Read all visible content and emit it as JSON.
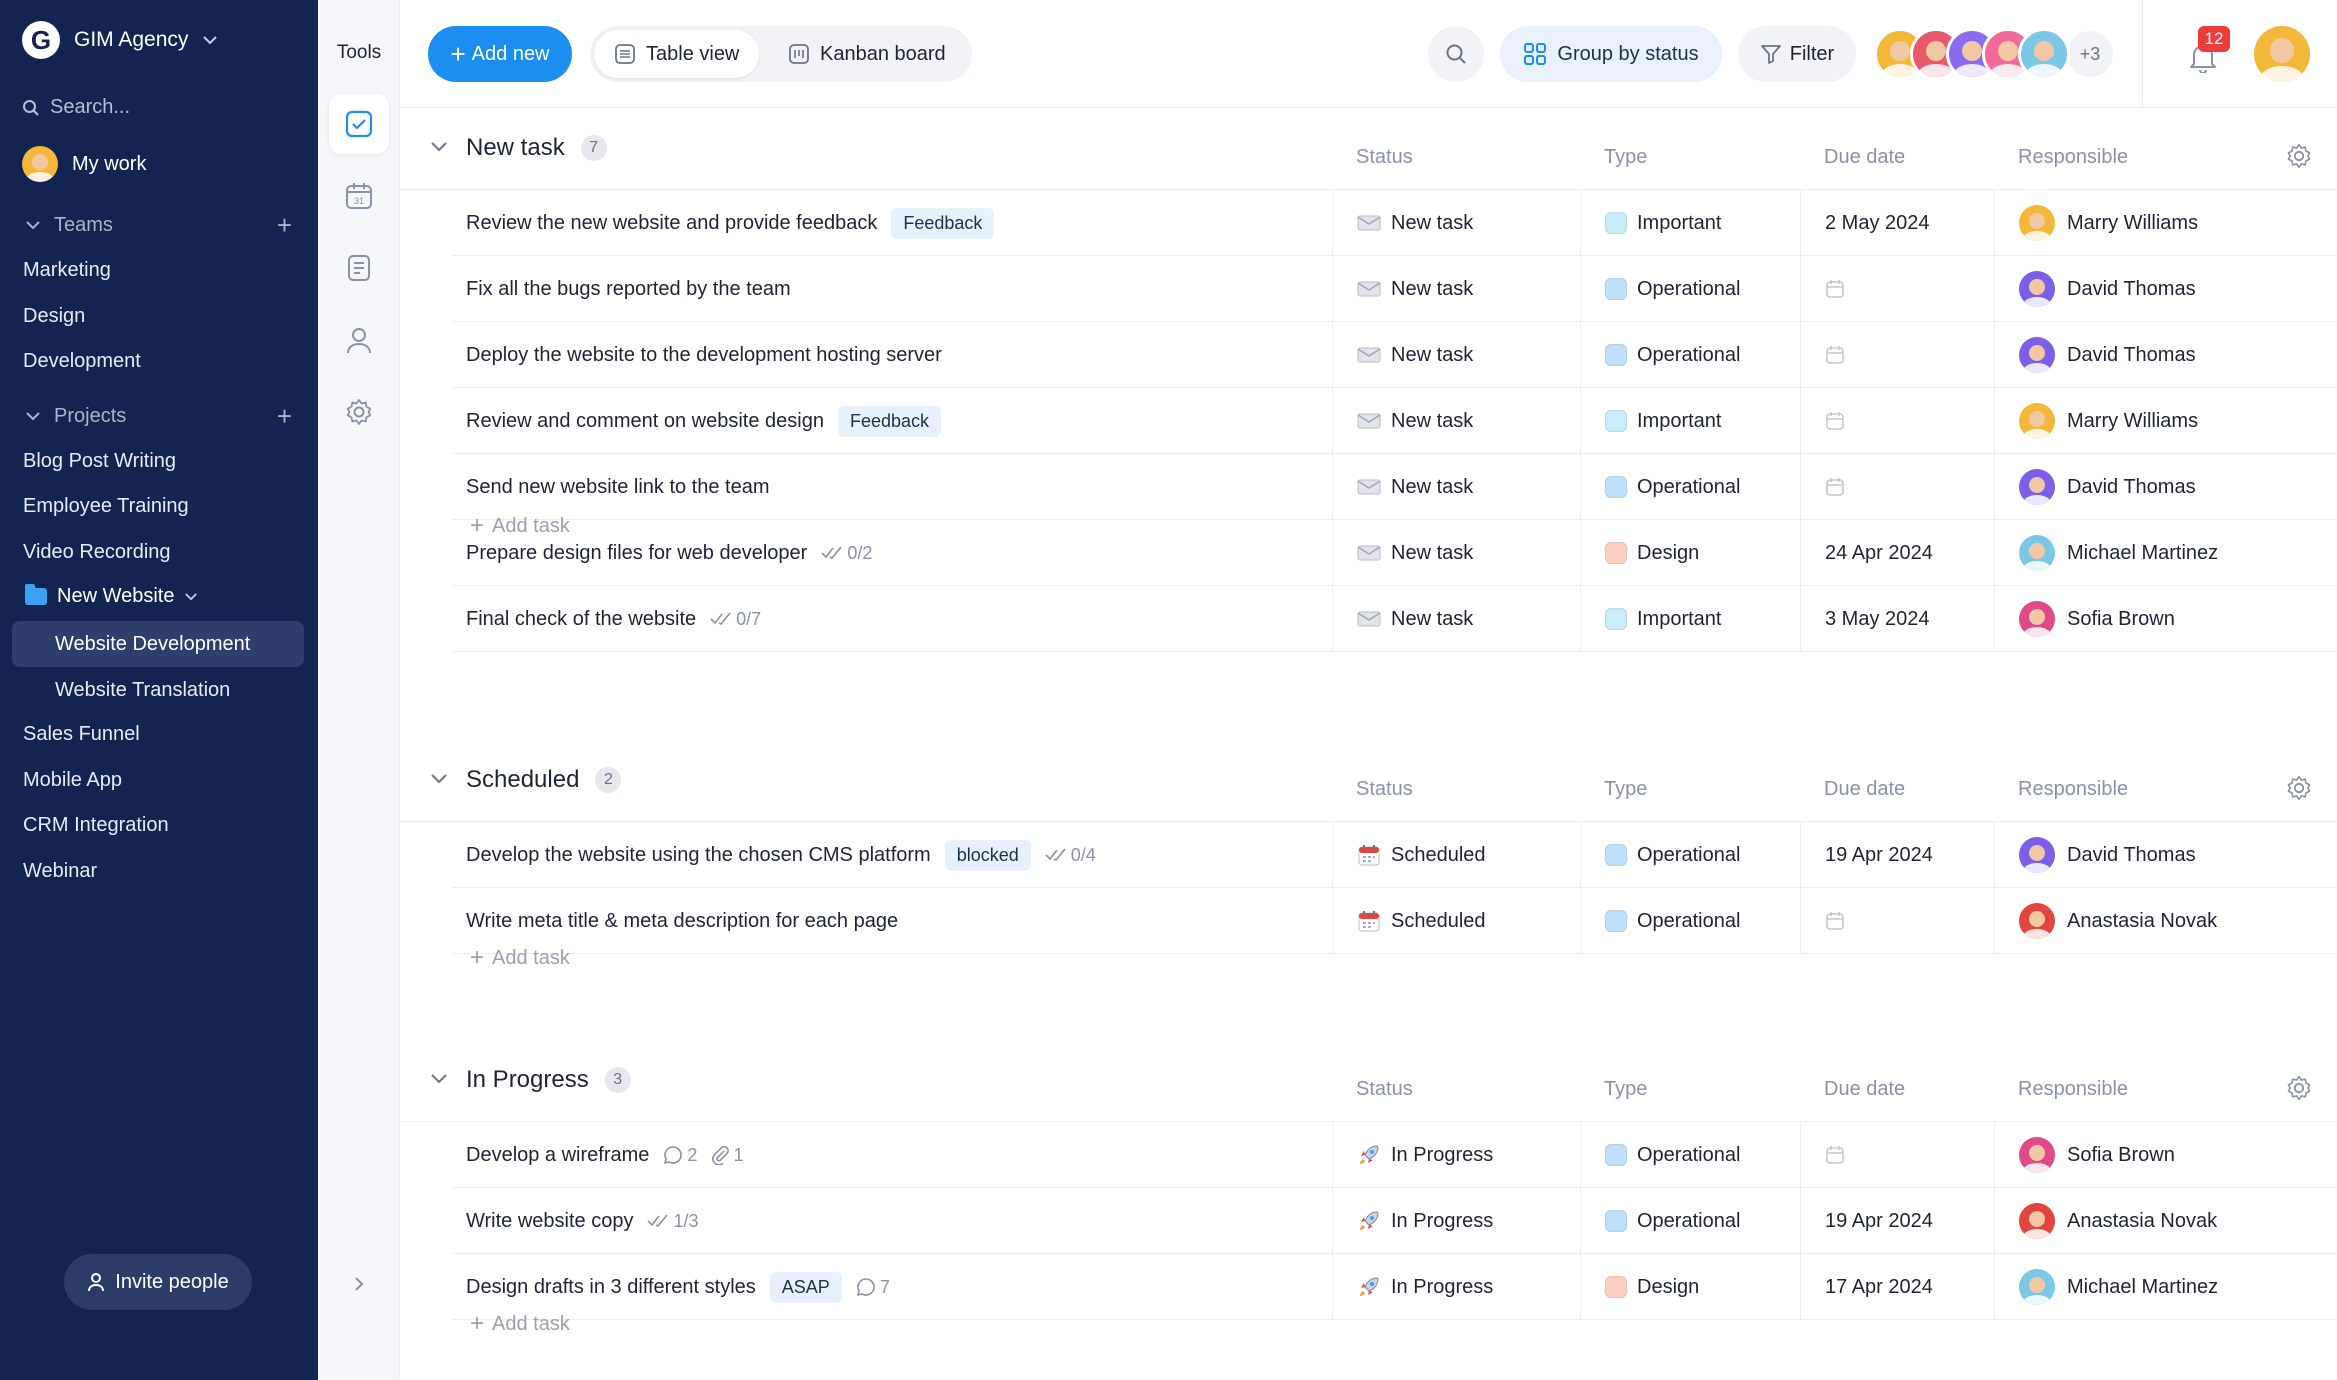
{
  "sidebar": {
    "brand": "GIM Agency",
    "search_placeholder": "Search...",
    "my_work": "My work",
    "teams_label": "Teams",
    "teams": [
      "Marketing",
      "Design",
      "Development"
    ],
    "projects_label": "Projects",
    "projects_top": [
      "Blog Post Writing",
      "Employee Training",
      "Video Recording"
    ],
    "folder": "New Website",
    "folder_items": [
      "Website Development",
      "Website Translation"
    ],
    "projects_bottom": [
      "Sales Funnel",
      "Mobile App",
      "CRM Integration",
      "Webinar"
    ],
    "invite": "Invite people"
  },
  "tools": {
    "title": "Tools"
  },
  "toolbar": {
    "add_new": "Add new",
    "table_view": "Table view",
    "kanban": "Kanban board",
    "group_by": "Group by status",
    "filter": "Filter",
    "more_people": "+3",
    "notifications": "12"
  },
  "columns": {
    "status": "Status",
    "type": "Type",
    "due": "Due date",
    "responsible": "Responsible"
  },
  "add_task": "Add task",
  "colors": {
    "sidebar_bg": "#142450",
    "accent": "#1c8ef0",
    "type_important": "#c9ecfb",
    "type_operational": "#bfe0fb",
    "type_design": "#fbcfc4"
  },
  "groups": [
    {
      "title": "New task",
      "count": "7",
      "tasks": [
        {
          "name": "Review the new website and provide feedback",
          "tag": "Feedback",
          "status": "New task",
          "type": "Important",
          "due": "2 May 2024",
          "responsible": "Marry Williams"
        },
        {
          "name": "Fix all the bugs reported by the team",
          "status": "New task",
          "type": "Operational",
          "due": "",
          "responsible": "David Thomas"
        },
        {
          "name": "Deploy the website to the development hosting server",
          "status": "New task",
          "type": "Operational",
          "due": "",
          "responsible": "David Thomas"
        },
        {
          "name": "Review and comment on website design",
          "tag": "Feedback",
          "status": "New task",
          "type": "Important",
          "due": "",
          "responsible": "Marry Williams"
        },
        {
          "name": "Send new website link to the team",
          "status": "New task",
          "type": "Operational",
          "due": "",
          "responsible": "David Thomas"
        },
        {
          "name": "Prepare design files for web developer",
          "checklist": "0/2",
          "status": "New task",
          "type": "Design",
          "due": "24 Apr 2024",
          "responsible": "Michael Martinez"
        },
        {
          "name": "Final check of the website",
          "checklist": "0/7",
          "status": "New task",
          "type": "Important",
          "due": "3 May 2024",
          "responsible": "Sofia Brown"
        }
      ]
    },
    {
      "title": "Scheduled",
      "count": "2",
      "tasks": [
        {
          "name": "Develop the website using the chosen CMS platform",
          "tag": "blocked",
          "checklist": "0/4",
          "status": "Scheduled",
          "type": "Operational",
          "due": "19 Apr 2024",
          "responsible": "David Thomas"
        },
        {
          "name": "Write meta title & meta description for each page",
          "status": "Scheduled",
          "type": "Operational",
          "due": "",
          "responsible": "Anastasia Novak"
        }
      ]
    },
    {
      "title": "In Progress",
      "count": "3",
      "tasks": [
        {
          "name": "Develop a wireframe",
          "comments": "2",
          "attachments": "1",
          "status": "In Progress",
          "type": "Operational",
          "due": "",
          "responsible": "Sofia Brown"
        },
        {
          "name": "Write website copy",
          "checklist": "1/3",
          "status": "In Progress",
          "type": "Operational",
          "due": "19 Apr 2024",
          "responsible": "Anastasia Novak"
        },
        {
          "name": "Design drafts in 3 different styles",
          "tag": "ASAP",
          "comments": "7",
          "status": "In Progress",
          "type": "Design",
          "due": "17 Apr 2024",
          "responsible": "Michael Martinez"
        }
      ]
    }
  ]
}
